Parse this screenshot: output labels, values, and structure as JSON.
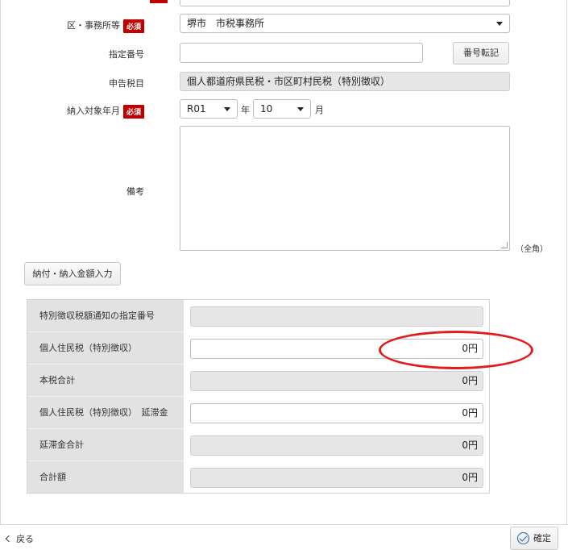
{
  "form": {
    "office_label": "区・事務所等",
    "required_badge": "必須",
    "office_value": "堺市　市税事務所",
    "designation_label": "指定番号",
    "designation_value": "",
    "number_transfer_button": "番号転記",
    "tax_item_label": "申告税目",
    "tax_item_value": "個人都道府県民税・市区町村民税（特別徴収）",
    "payment_period_label": "納入対象年月",
    "year_value": "R01",
    "year_unit": "年",
    "month_value": "10",
    "month_unit": "月",
    "remarks_label": "備考",
    "remarks_value": "",
    "remarks_note": "（全角）",
    "amount_entry_button": "納付・納入金額入力"
  },
  "amount_table": {
    "rows": [
      {
        "label": "特別徴収税額通知の指定番号",
        "value": "",
        "readonly": true
      },
      {
        "label": "個人住民税（特別徴収）",
        "value": "0円",
        "readonly": false
      },
      {
        "label": "本税合計",
        "value": "0円",
        "readonly": true
      },
      {
        "label": "個人住民税（特別徴収）　延滞金",
        "value": "0円",
        "readonly": false
      },
      {
        "label": "延滞金合計",
        "value": "0円",
        "readonly": true
      },
      {
        "label": "合計額",
        "value": "0円",
        "readonly": true
      }
    ]
  },
  "annotation": {
    "color": "#e31b1b",
    "shape": "ellipse"
  },
  "footer": {
    "back_label": "戻る",
    "confirm_label": "確定"
  },
  "colors": {
    "required": "#c00000",
    "readonly_bg": "#e6e6e6",
    "label_column_bg": "#e2e2e2",
    "confirm_icon": "#1d63b4"
  }
}
